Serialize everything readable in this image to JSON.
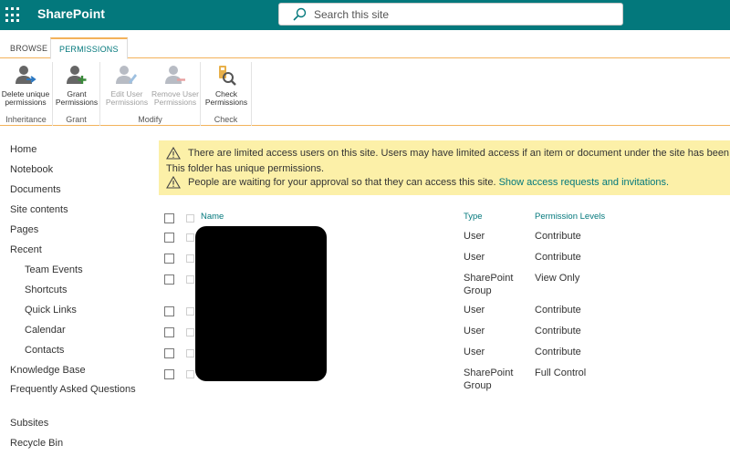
{
  "suite": {
    "brand": "SharePoint",
    "search_placeholder": "Search this site"
  },
  "tabs": [
    {
      "label": "BROWSE"
    },
    {
      "label": "PERMISSIONS"
    }
  ],
  "ribbon": {
    "groups": [
      {
        "label": "Inheritance",
        "buttons": [
          {
            "label": "Delete unique permissions",
            "icon": "delete-unique-permissions-icon"
          }
        ]
      },
      {
        "label": "Grant",
        "buttons": [
          {
            "label": "Grant Permissions",
            "icon": "grant-permissions-icon"
          }
        ]
      },
      {
        "label": "Modify",
        "buttons": [
          {
            "label": "Edit User Permissions",
            "icon": "edit-user-permissions-icon",
            "disabled": true
          },
          {
            "label": "Remove User Permissions",
            "icon": "remove-user-permissions-icon",
            "disabled": true
          }
        ]
      },
      {
        "label": "Check",
        "buttons": [
          {
            "label": "Check Permissions",
            "icon": "check-permissions-icon"
          }
        ]
      }
    ]
  },
  "nav": {
    "items": [
      {
        "label": "Home"
      },
      {
        "label": "Notebook"
      },
      {
        "label": "Documents"
      },
      {
        "label": "Site contents"
      },
      {
        "label": "Pages"
      },
      {
        "label": "Recent"
      },
      {
        "label": "Team Events"
      },
      {
        "label": "Shortcuts"
      },
      {
        "label": "Quick Links"
      },
      {
        "label": "Calendar"
      },
      {
        "label": "Contacts"
      },
      {
        "label": "Knowledge Base"
      },
      {
        "label": "Frequently Asked Questions"
      },
      {
        "label": "Subsites"
      },
      {
        "label": "Recycle Bin"
      }
    ]
  },
  "notice": {
    "line1": "There are limited access users on this site. Users may have limited access if an item or document under the site has been shared",
    "line2": "This folder has unique permissions.",
    "line3_text": "People are waiting for your approval so that they can access this site.",
    "line3_link": "Show access requests and invitations."
  },
  "table": {
    "headers": {
      "name": "Name",
      "type": "Type",
      "level": "Permission Levels"
    },
    "rows": [
      {
        "type": "User",
        "level": "Contribute"
      },
      {
        "type": "User",
        "level": "Contribute"
      },
      {
        "type": "SharePoint Group",
        "level": "View Only"
      },
      {
        "type": "User",
        "level": "Contribute"
      },
      {
        "type": "User",
        "level": "Contribute"
      },
      {
        "type": "User",
        "level": "Contribute"
      },
      {
        "type": "SharePoint Group",
        "level": "Full Control"
      }
    ]
  },
  "colors": {
    "suite_bar": "#03787c",
    "accent": "#f3b25a",
    "notice_bg": "#fcf0a8"
  }
}
